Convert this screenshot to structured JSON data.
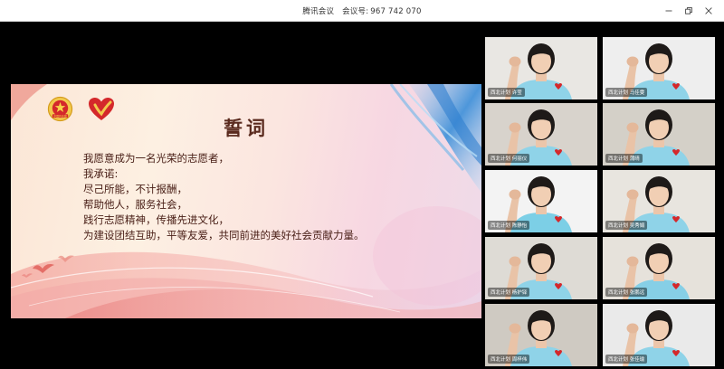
{
  "window": {
    "app_name": "腾讯会议",
    "meeting_id_label": "会议号:",
    "meeting_id": "967 742 070"
  },
  "slide": {
    "title": "誓词",
    "lines": [
      "我愿意成为一名光荣的志愿者，",
      "我承诺:",
      "尽己所能，不计报酬，",
      "帮助他人，服务社会，",
      "践行志愿精神，传播先进文化，",
      "为建设团结互助，平等友爱，共同前进的美好社会贡献力量。"
    ],
    "icons": [
      "youth-league-emblem",
      "volunteer-heart-logo"
    ]
  },
  "participants": [
    {
      "name": "西北计划 许莹",
      "shirt": "#8fd3e8",
      "bg": "#e9e7e3"
    },
    {
      "name": "西北计划 马佳雯",
      "shirt": "#8fd3e8",
      "bg": "#eeeeee"
    },
    {
      "name": "西北计划 何丽仪",
      "shirt": "#8fd3e8",
      "bg": "#d8d3cc"
    },
    {
      "name": "西北计划 蒲晴",
      "shirt": "#8fd3e8",
      "bg": "#d4d0c8"
    },
    {
      "name": "西北计划 陈静怡",
      "shirt": "#7ccfe6",
      "bg": "#f3f3f3"
    },
    {
      "name": "西北计划 吴秀娟",
      "shirt": "#8fd3e8",
      "bg": "#e8e5df"
    },
    {
      "name": "西北计划 杨护铎",
      "shirt": "#8fd3e8",
      "bg": "#dedbd5"
    },
    {
      "name": "西北计划 张鹏远",
      "shirt": "#86cfe6",
      "bg": "#e6e2db"
    },
    {
      "name": "西北计划 周梓伟",
      "shirt": "#8fd3e8",
      "bg": "#cfcac2"
    },
    {
      "name": "西北计划 张佳瑜",
      "shirt": "#8fd3e8",
      "bg": "#eaeaea"
    }
  ],
  "colors": {
    "titlebar_bg": "#ffffff",
    "app_bg": "#000000",
    "oath_text": "#4a2018",
    "accent_red": "#d4282b",
    "accent_blue": "#3b8fd9"
  }
}
